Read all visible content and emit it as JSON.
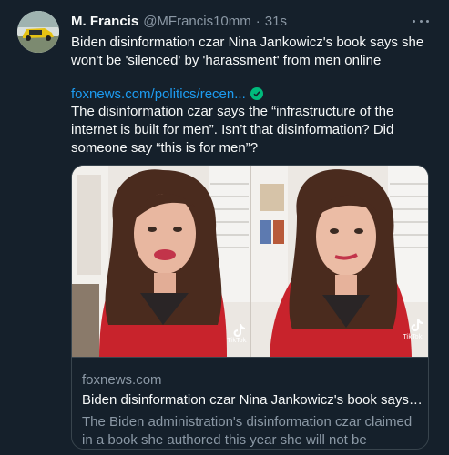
{
  "author": {
    "name": "M. Francis",
    "handle": "@MFrancis10mm",
    "separator": "·",
    "time": "31s"
  },
  "tweet": {
    "text": "Biden disinformation czar Nina Jankowicz's book says she won't be 'silenced' by 'harassment' from men online",
    "quote_link": "foxnews.com/politics/recen...",
    "commentary": "The disinformation czar says the “infrastructure of the internet is built for men”. Isn’t that disinformation? Did someone say “this is for men”?"
  },
  "card": {
    "domain": "foxnews.com",
    "title": "Biden disinformation czar Nina Jankowicz's book says s...",
    "description": "The Biden administration's disinformation czar claimed in a book she authored this year she will not be \"silenced..."
  },
  "media": {
    "watermark_left": "TikTok",
    "watermark_right": "TikTok"
  },
  "icons": {
    "more": "more-horizontal-icon",
    "verified": "verified-check-icon",
    "tiktok": "tiktok-logo-icon"
  },
  "colors": {
    "background": "#15202b",
    "link": "#1d9bf0",
    "secondary_text": "#8b98a5",
    "verified": "#00ba7c",
    "border": "#38444d"
  }
}
